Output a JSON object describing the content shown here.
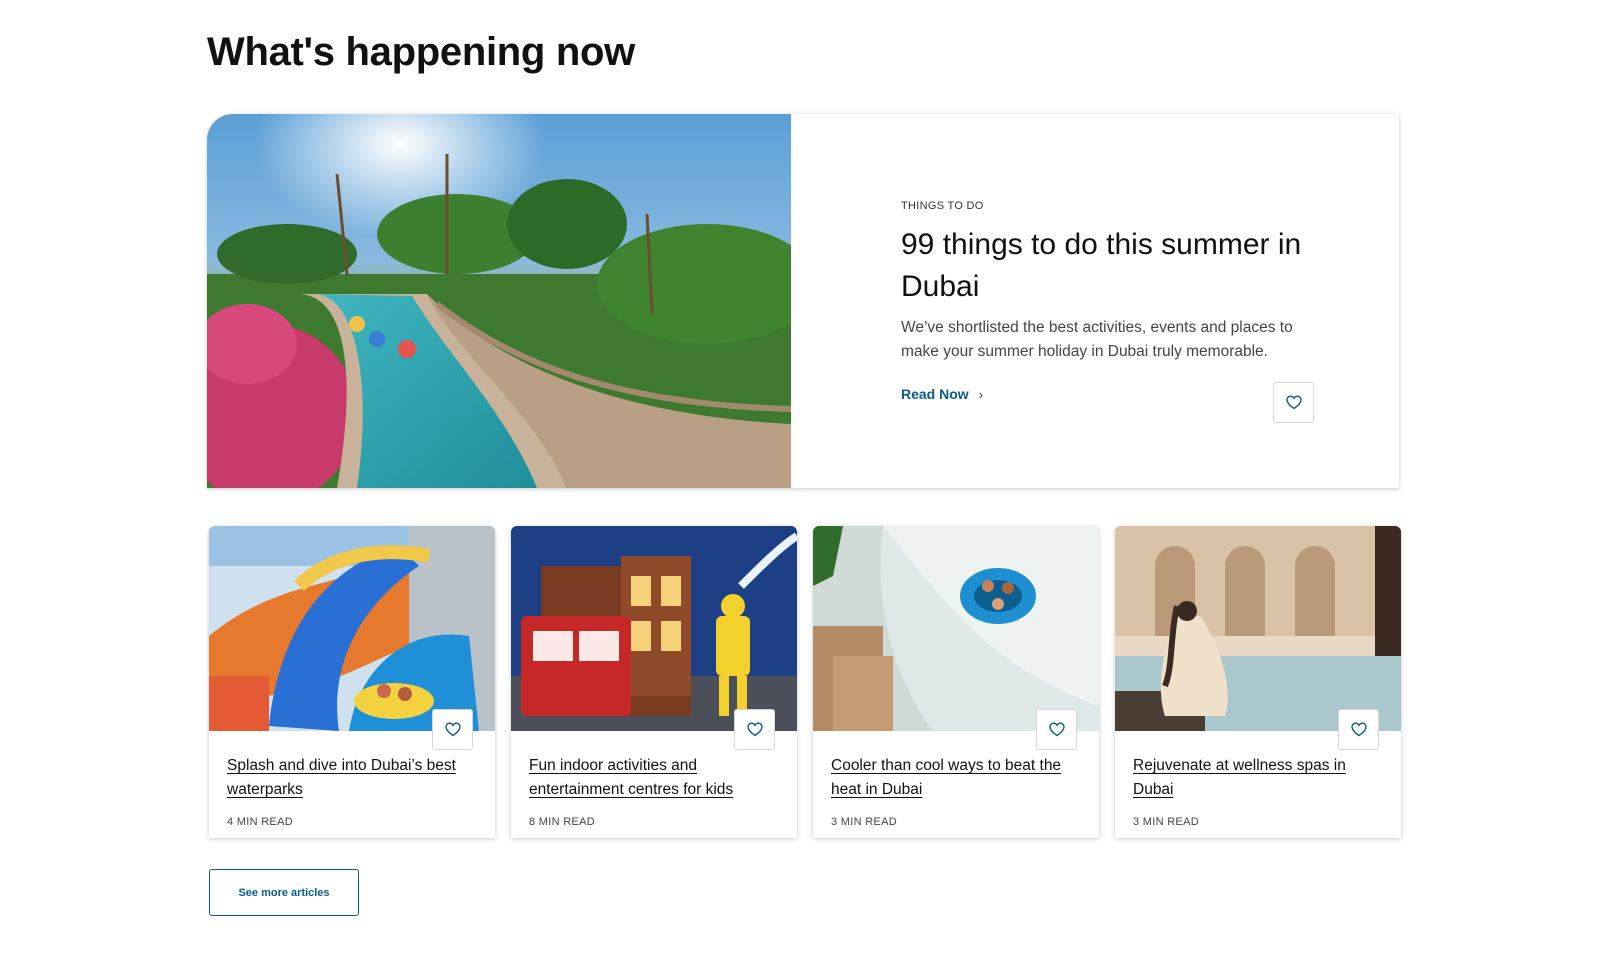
{
  "section": {
    "title": "What's happening now"
  },
  "featured": {
    "eyebrow": "THINGS TO DO",
    "title": "99 things to do this summer in Dubai",
    "description": "We’ve shortlisted the best activities, events and places to make your summer holiday in Dubai truly memorable.",
    "cta_label": "Read Now",
    "cta_icon": "chevron-right-icon",
    "favorite_icon": "heart-icon",
    "image_alt": "Lazy river waterpark with palm trees"
  },
  "articles": [
    {
      "title": "Splash and dive into Dubai’s best waterparks",
      "meta": "4 MIN READ",
      "favorite_icon": "heart-icon"
    },
    {
      "title": "Fun indoor activities and entertainment centres for kids",
      "meta": "8 MIN READ",
      "favorite_icon": "heart-icon"
    },
    {
      "title": "Cooler than cool ways to beat the heat in Dubai",
      "meta": "3 MIN READ",
      "favorite_icon": "heart-icon"
    },
    {
      "title": "Rejuvenate at wellness spas in Dubai",
      "meta": "3 MIN READ",
      "favorite_icon": "heart-icon"
    }
  ],
  "see_more": {
    "label": "See more articles"
  },
  "colors": {
    "accent": "#0a5b8c",
    "text": "#111111",
    "muted": "#444444"
  }
}
